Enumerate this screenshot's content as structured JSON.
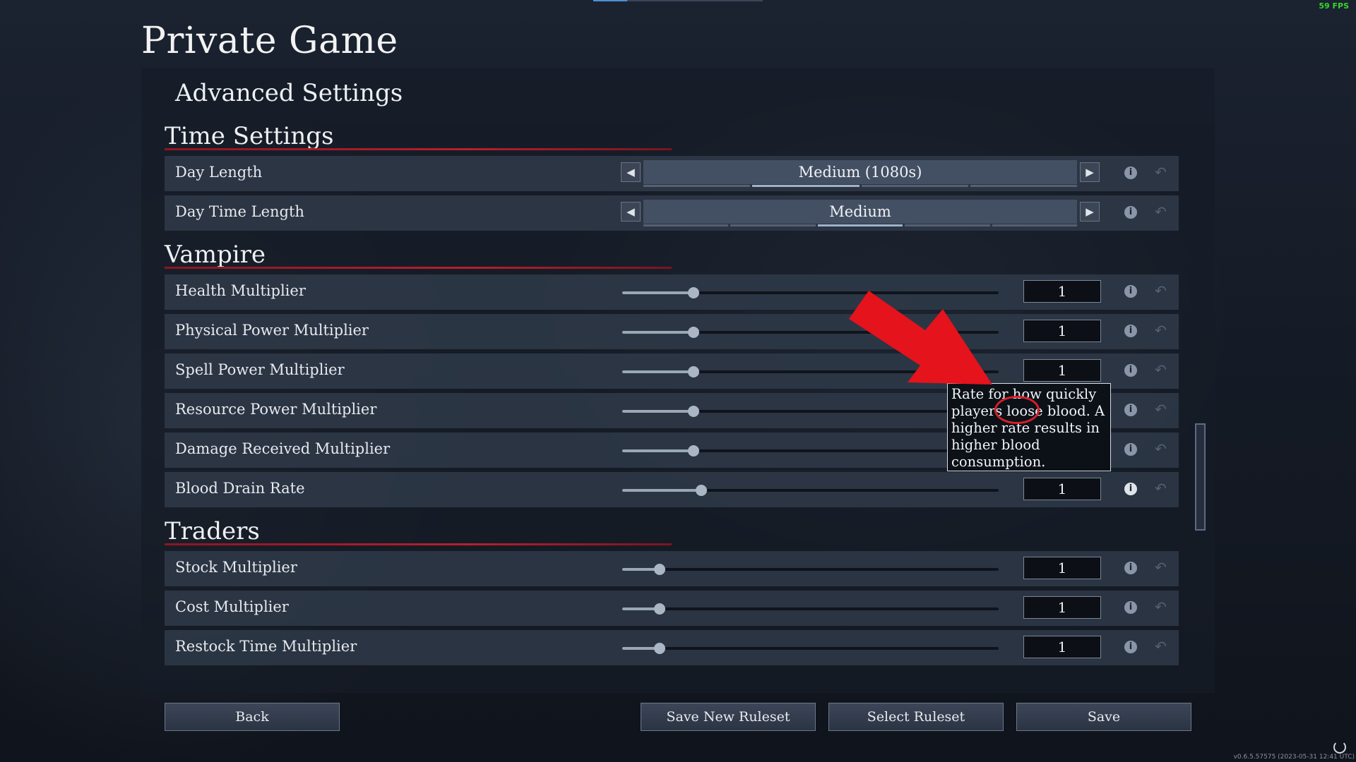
{
  "fps": "59 FPS",
  "title": "Private Game",
  "subtitle": "Advanced Settings",
  "sections": {
    "time": {
      "title": "Time Settings"
    },
    "vampire": {
      "title": "Vampire"
    },
    "traders": {
      "title": "Traders"
    }
  },
  "time_settings": [
    {
      "label": "Day Length",
      "value": "Medium (1080s)",
      "segments": 4,
      "selected_segment": 2
    },
    {
      "label": "Day Time Length",
      "value": "Medium",
      "segments": 5,
      "selected_segment": 3
    }
  ],
  "vampire_settings": [
    {
      "label": "Health Multiplier",
      "value": "1",
      "slider_fraction": 0.19
    },
    {
      "label": "Physical Power Multiplier",
      "value": "1",
      "slider_fraction": 0.19
    },
    {
      "label": "Spell Power Multiplier",
      "value": "1",
      "slider_fraction": 0.19
    },
    {
      "label": "Resource Power Multiplier",
      "value": "1",
      "slider_fraction": 0.19
    },
    {
      "label": "Damage Received Multiplier",
      "value": "1",
      "slider_fraction": 0.19
    },
    {
      "label": "Blood Drain Rate",
      "value": "1",
      "slider_fraction": 0.21
    }
  ],
  "trader_settings": [
    {
      "label": "Stock Multiplier",
      "value": "1",
      "slider_fraction": 0.1
    },
    {
      "label": "Cost Multiplier",
      "value": "1",
      "slider_fraction": 0.1
    },
    {
      "label": "Restock Time Multiplier",
      "value": "1",
      "slider_fraction": 0.1
    }
  ],
  "tooltip": {
    "text": "Rate for how quickly players loose blood. A higher rate results in higher blood consumption."
  },
  "buttons": {
    "back": "Back",
    "save_new_ruleset": "Save New Ruleset",
    "select_ruleset": "Select Ruleset",
    "save": "Save"
  },
  "version": "v0.6.5.57575 (2023-05-31 12:41 UTC)",
  "icons": {
    "left": "triangle-left-icon",
    "right": "triangle-right-icon",
    "info": "info-icon",
    "reset": "reset-icon",
    "loading": "loading-icon"
  },
  "colors": {
    "accent_red": "#b81f2c",
    "fps_green": "#38d62c",
    "annotation_red": "#e5131c"
  }
}
